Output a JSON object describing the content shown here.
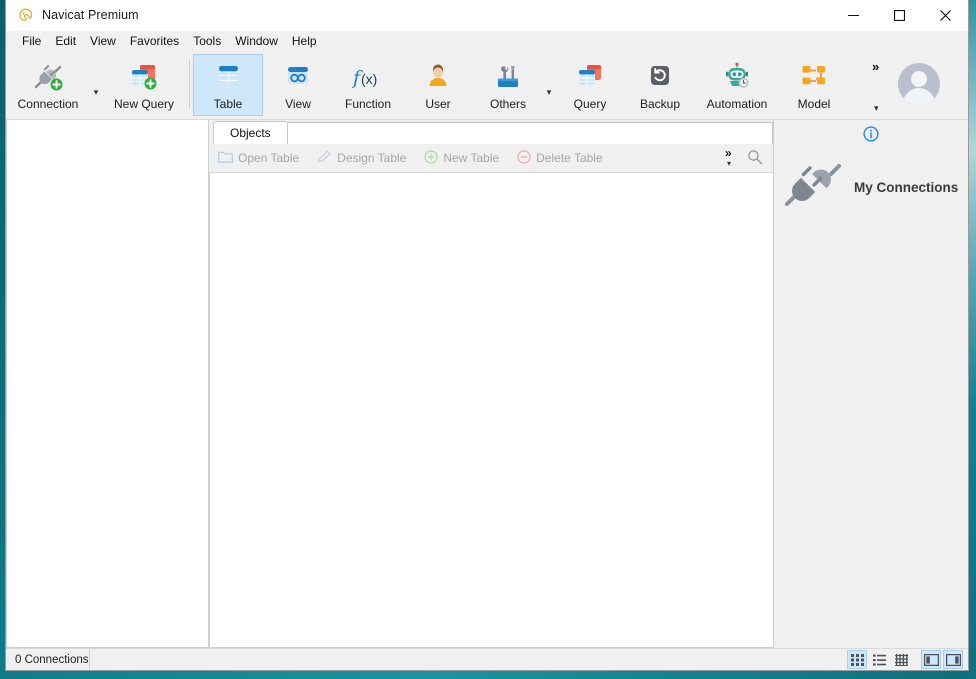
{
  "window": {
    "title": "Navicat Premium",
    "app_icon": "navicat-logo-icon",
    "controls": {
      "minimize": "minimize-icon",
      "maximize": "maximize-icon",
      "close": "close-icon"
    }
  },
  "menubar": {
    "items": [
      {
        "label": "File"
      },
      {
        "label": "Edit"
      },
      {
        "label": "View"
      },
      {
        "label": "Favorites"
      },
      {
        "label": "Tools"
      },
      {
        "label": "Window"
      },
      {
        "label": "Help"
      }
    ]
  },
  "toolbar": {
    "buttons": [
      {
        "label": "Connection",
        "icon": "connection-plug-add-icon",
        "has_caret": true,
        "active": false
      },
      {
        "label": "New Query",
        "icon": "new-query-add-icon",
        "has_caret": false,
        "active": false
      },
      {
        "label": "Table",
        "icon": "table-icon",
        "has_caret": false,
        "active": true
      },
      {
        "label": "View",
        "icon": "view-glasses-icon",
        "has_caret": false,
        "active": false
      },
      {
        "label": "Function",
        "icon": "function-fx-icon",
        "has_caret": false,
        "active": false
      },
      {
        "label": "User",
        "icon": "user-person-icon",
        "has_caret": false,
        "active": false
      },
      {
        "label": "Others",
        "icon": "others-toolbox-icon",
        "has_caret": true,
        "active": false
      },
      {
        "label": "Query",
        "icon": "query-table-icon",
        "has_caret": false,
        "active": false
      },
      {
        "label": "Backup",
        "icon": "backup-restore-icon",
        "has_caret": false,
        "active": false
      },
      {
        "label": "Automation",
        "icon": "automation-robot-icon",
        "has_caret": false,
        "active": false
      },
      {
        "label": "Model",
        "icon": "model-diagram-icon",
        "has_caret": false,
        "active": false
      }
    ],
    "overflow": "»",
    "overflow_caret": "▾",
    "avatar": "user-avatar"
  },
  "tabs": {
    "items": [
      {
        "label": "Objects",
        "active": true
      }
    ]
  },
  "object_toolbar": {
    "buttons": [
      {
        "label": "Open Table",
        "icon": "folder-open-icon",
        "enabled": false
      },
      {
        "label": "Design Table",
        "icon": "pencil-icon",
        "enabled": false
      },
      {
        "label": "New Table",
        "icon": "circle-plus-icon",
        "enabled": false
      },
      {
        "label": "Delete Table",
        "icon": "circle-minus-icon",
        "enabled": false
      }
    ],
    "overflow": "»",
    "overflow_caret": "▾",
    "search_icon": "search-icon"
  },
  "right_panel": {
    "info_icon": "info-circle-icon",
    "connections_icon": "connection-plug-icon",
    "connections_title": "My Connections"
  },
  "statusbar": {
    "text": "0 Connections",
    "view_buttons": [
      {
        "icon": "grid-view-icon",
        "active": true
      },
      {
        "icon": "list-view-icon",
        "active": false
      },
      {
        "icon": "detail-grid-view-icon",
        "active": false
      }
    ],
    "panel_buttons": [
      {
        "icon": "left-panel-toggle-icon",
        "active": true
      },
      {
        "icon": "right-panel-toggle-icon",
        "active": true
      }
    ]
  },
  "colors": {
    "accent": "#0078d7",
    "tab_active": "#ffffff",
    "toolbar_selected": "#cee7fa",
    "desktop": "#0c6b78",
    "info_blue": "#1f8bf0"
  }
}
